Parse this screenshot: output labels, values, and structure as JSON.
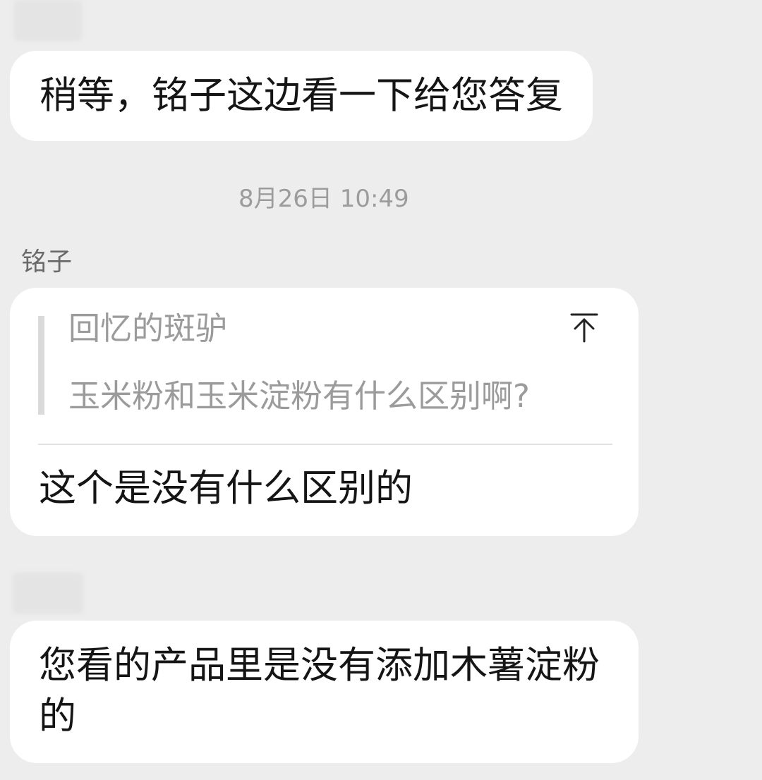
{
  "chat": {
    "message_1": {
      "text": "稍等，铭子这边看一下给您答复"
    },
    "timestamp": "8月26日 10:49",
    "message_2": {
      "sender": "铭子",
      "quote_author": "回忆的斑驴",
      "quote_text": "玉米粉和玉米淀粉有什么区别啊?",
      "quote_icon": "arrow-to-top-icon",
      "text": "这个是没有什么区别的"
    },
    "message_3": {
      "text": "您看的产品里是没有添加木薯淀粉的"
    }
  },
  "colors": {
    "background": "#ededed",
    "bubble": "#ffffff",
    "text": "#151515",
    "muted_text": "#9b9b9b",
    "sender_text": "#6a6a6a"
  }
}
